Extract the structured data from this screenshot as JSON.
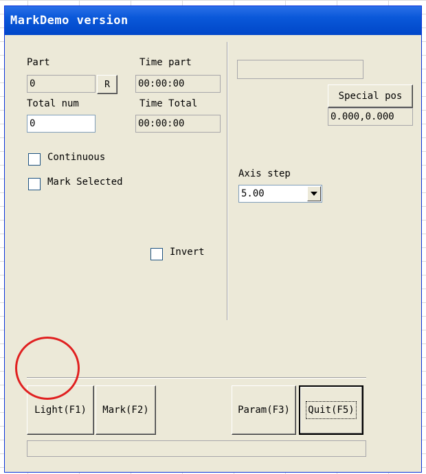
{
  "window": {
    "title": "MarkDemo version"
  },
  "left": {
    "part_label": "Part",
    "part_value": "0",
    "reset_button": "R",
    "time_part_label": "Time part",
    "time_part_value": "00:00:00",
    "total_num_label": "Total num",
    "total_num_value": "0",
    "time_total_label": "Time Total",
    "time_total_value": "00:00:00",
    "continuous_label": "Continuous",
    "continuous_checked": false,
    "mark_selected_label": "Mark Selected",
    "mark_selected_checked": false,
    "invert_label": "Invert",
    "invert_checked": false
  },
  "right": {
    "top_field_value": "",
    "special_pos_button": "Special pos",
    "special_pos_value": "0.000,0.000",
    "axis_step_label": "Axis step",
    "axis_step_selected": "5.00"
  },
  "buttons": {
    "light": "Light(F1)",
    "mark": "Mark(F2)",
    "param": "Param(F3)",
    "quit": "Quit(F5)"
  },
  "status_bar": {
    "text": ""
  },
  "annotation": {
    "highlight_color": "#e02020"
  },
  "colors": {
    "title_bar": "#0a58d9",
    "dialog_bg": "#ece9d8"
  }
}
